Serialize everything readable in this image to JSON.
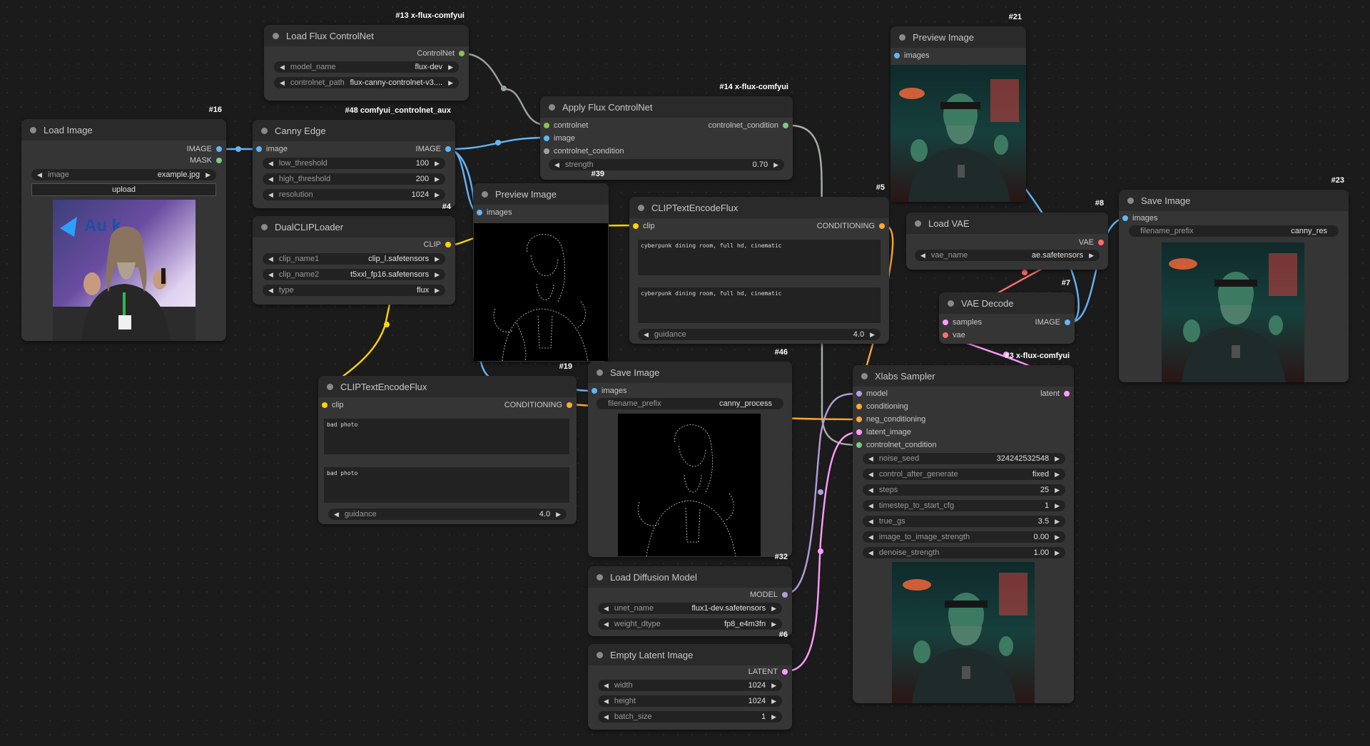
{
  "colors": {
    "image": "#64b5f6",
    "mask": "#81c784",
    "controlnet": "#8bc34a",
    "clip": "#ffd500",
    "conditioning": "#ffa931",
    "model": "#b39ddb",
    "latent": "#ff9cf9",
    "vae": "#ff6e6e",
    "generic": "#a0a0a0"
  },
  "nodes": {
    "load_controlnet": {
      "id": "#13 x-flux-comfyui",
      "title": "Load Flux ControlNet",
      "out_controlnet": "ControlNet",
      "w_model_name": {
        "label": "model_name",
        "value": "flux-dev"
      },
      "w_controlnet_path": {
        "label": "controlnet_path",
        "value": "flux-canny-controlnet-v3...."
      }
    },
    "load_image": {
      "id": "#16",
      "title": "Load Image",
      "out_image": "IMAGE",
      "out_mask": "MASK",
      "w_image": {
        "label": "image",
        "value": "example.jpg"
      },
      "upload": "upload",
      "photo_text": "Au k"
    },
    "canny_edge": {
      "id": "#48 comfyui_controlnet_aux",
      "title": "Canny Edge",
      "in_image": "image",
      "out_image": "IMAGE",
      "w_low": {
        "label": "low_threshold",
        "value": "100"
      },
      "w_high": {
        "label": "high_threshold",
        "value": "200"
      },
      "w_res": {
        "label": "resolution",
        "value": "1024"
      }
    },
    "apply_controlnet": {
      "id": "#14 x-flux-comfyui",
      "title": "Apply Flux ControlNet",
      "in_controlnet": "controlnet",
      "in_image": "image",
      "in_cond": "controlnet_condition",
      "out_cond": "controlnet_condition",
      "w_strength": {
        "label": "strength",
        "value": "0.70"
      }
    },
    "dual_clip": {
      "id": "#4",
      "title": "DualCLIPLoader",
      "out_clip": "CLIP",
      "w_clip1": {
        "label": "clip_name1",
        "value": "clip_l.safetensors"
      },
      "w_clip2": {
        "label": "clip_name2",
        "value": "t5xxl_fp16.safetensors"
      },
      "w_type": {
        "label": "type",
        "value": "flux"
      }
    },
    "preview_canny": {
      "id": "#39",
      "title": "Preview Image",
      "in_images": "images"
    },
    "clip_pos": {
      "id": "#5",
      "title": "CLIPTextEncodeFlux",
      "in_clip": "clip",
      "out_cond": "CONDITIONING",
      "text1": "cyberpunk dining room, full hd, cinematic",
      "text2": "cyberpunk dining room, full hd, cinematic",
      "w_guidance": {
        "label": "guidance",
        "value": "4.0"
      }
    },
    "clip_neg": {
      "id": "#19",
      "title": "CLIPTextEncodeFlux",
      "in_clip": "clip",
      "out_cond": "CONDITIONING",
      "text1": "bad photo",
      "text2": "bad photo",
      "w_guidance": {
        "label": "guidance",
        "value": "4.0"
      }
    },
    "save_canny": {
      "id": "#46",
      "title": "Save Image",
      "in_images": "images",
      "w_prefix": {
        "label": "filename_prefix",
        "value": "canny_process"
      }
    },
    "preview_result": {
      "id": "#21",
      "title": "Preview Image",
      "in_images": "images"
    },
    "load_vae": {
      "id": "#8",
      "title": "Load VAE",
      "out_vae": "VAE",
      "w_vae": {
        "label": "vae_name",
        "value": "ae.safetensors"
      }
    },
    "vae_decode": {
      "id": "#7",
      "title": "VAE Decode",
      "in_samples": "samples",
      "in_vae": "vae",
      "out_image": "IMAGE"
    },
    "save_result": {
      "id": "#23",
      "title": "Save Image",
      "in_images": "images",
      "w_prefix": {
        "label": "filename_prefix",
        "value": "canny_res"
      }
    },
    "sampler": {
      "id": "#3 x-flux-comfyui",
      "title": "Xlabs Sampler",
      "in_model": "model",
      "in_cond": "conditioning",
      "in_neg": "neg_conditioning",
      "in_latent": "latent_image",
      "in_cn": "controlnet_condition",
      "out_latent": "latent",
      "w_seed": {
        "label": "noise_seed",
        "value": "324242532548"
      },
      "w_cag": {
        "label": "control_after_generate",
        "value": "fixed"
      },
      "w_steps": {
        "label": "steps",
        "value": "25"
      },
      "w_tsc": {
        "label": "timestep_to_start_cfg",
        "value": "1"
      },
      "w_gs": {
        "label": "true_gs",
        "value": "3.5"
      },
      "w_its": {
        "label": "image_to_image_strength",
        "value": "0.00"
      },
      "w_dn": {
        "label": "denoise_strength",
        "value": "1.00"
      }
    },
    "load_diffusion": {
      "id": "#32",
      "title": "Load Diffusion Model",
      "out_model": "MODEL",
      "w_unet": {
        "label": "unet_name",
        "value": "flux1-dev.safetensors"
      },
      "w_dtype": {
        "label": "weight_dtype",
        "value": "fp8_e4m3fn"
      }
    },
    "empty_latent": {
      "id": "#6",
      "title": "Empty Latent Image",
      "out_latent": "LATENT",
      "w_width": {
        "label": "width",
        "value": "1024"
      },
      "w_height": {
        "label": "height",
        "value": "1024"
      },
      "w_batch": {
        "label": "batch_size",
        "value": "1"
      }
    }
  }
}
